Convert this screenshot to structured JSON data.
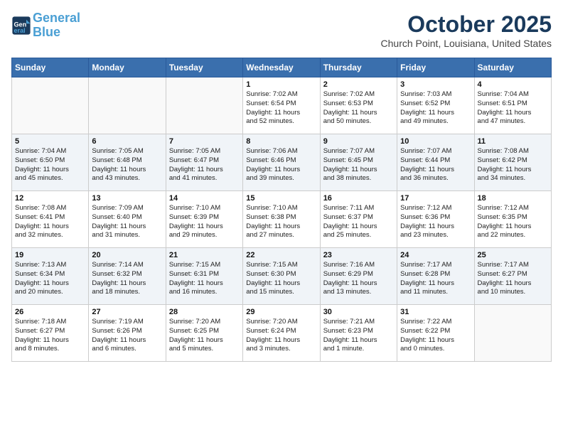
{
  "header": {
    "logo_line1": "General",
    "logo_line2": "Blue",
    "month": "October 2025",
    "location": "Church Point, Louisiana, United States"
  },
  "weekdays": [
    "Sunday",
    "Monday",
    "Tuesday",
    "Wednesday",
    "Thursday",
    "Friday",
    "Saturday"
  ],
  "weeks": [
    [
      {
        "day": "",
        "info": ""
      },
      {
        "day": "",
        "info": ""
      },
      {
        "day": "",
        "info": ""
      },
      {
        "day": "1",
        "info": "Sunrise: 7:02 AM\nSunset: 6:54 PM\nDaylight: 11 hours\nand 52 minutes."
      },
      {
        "day": "2",
        "info": "Sunrise: 7:02 AM\nSunset: 6:53 PM\nDaylight: 11 hours\nand 50 minutes."
      },
      {
        "day": "3",
        "info": "Sunrise: 7:03 AM\nSunset: 6:52 PM\nDaylight: 11 hours\nand 49 minutes."
      },
      {
        "day": "4",
        "info": "Sunrise: 7:04 AM\nSunset: 6:51 PM\nDaylight: 11 hours\nand 47 minutes."
      }
    ],
    [
      {
        "day": "5",
        "info": "Sunrise: 7:04 AM\nSunset: 6:50 PM\nDaylight: 11 hours\nand 45 minutes."
      },
      {
        "day": "6",
        "info": "Sunrise: 7:05 AM\nSunset: 6:48 PM\nDaylight: 11 hours\nand 43 minutes."
      },
      {
        "day": "7",
        "info": "Sunrise: 7:05 AM\nSunset: 6:47 PM\nDaylight: 11 hours\nand 41 minutes."
      },
      {
        "day": "8",
        "info": "Sunrise: 7:06 AM\nSunset: 6:46 PM\nDaylight: 11 hours\nand 39 minutes."
      },
      {
        "day": "9",
        "info": "Sunrise: 7:07 AM\nSunset: 6:45 PM\nDaylight: 11 hours\nand 38 minutes."
      },
      {
        "day": "10",
        "info": "Sunrise: 7:07 AM\nSunset: 6:44 PM\nDaylight: 11 hours\nand 36 minutes."
      },
      {
        "day": "11",
        "info": "Sunrise: 7:08 AM\nSunset: 6:42 PM\nDaylight: 11 hours\nand 34 minutes."
      }
    ],
    [
      {
        "day": "12",
        "info": "Sunrise: 7:08 AM\nSunset: 6:41 PM\nDaylight: 11 hours\nand 32 minutes."
      },
      {
        "day": "13",
        "info": "Sunrise: 7:09 AM\nSunset: 6:40 PM\nDaylight: 11 hours\nand 31 minutes."
      },
      {
        "day": "14",
        "info": "Sunrise: 7:10 AM\nSunset: 6:39 PM\nDaylight: 11 hours\nand 29 minutes."
      },
      {
        "day": "15",
        "info": "Sunrise: 7:10 AM\nSunset: 6:38 PM\nDaylight: 11 hours\nand 27 minutes."
      },
      {
        "day": "16",
        "info": "Sunrise: 7:11 AM\nSunset: 6:37 PM\nDaylight: 11 hours\nand 25 minutes."
      },
      {
        "day": "17",
        "info": "Sunrise: 7:12 AM\nSunset: 6:36 PM\nDaylight: 11 hours\nand 23 minutes."
      },
      {
        "day": "18",
        "info": "Sunrise: 7:12 AM\nSunset: 6:35 PM\nDaylight: 11 hours\nand 22 minutes."
      }
    ],
    [
      {
        "day": "19",
        "info": "Sunrise: 7:13 AM\nSunset: 6:34 PM\nDaylight: 11 hours\nand 20 minutes."
      },
      {
        "day": "20",
        "info": "Sunrise: 7:14 AM\nSunset: 6:32 PM\nDaylight: 11 hours\nand 18 minutes."
      },
      {
        "day": "21",
        "info": "Sunrise: 7:15 AM\nSunset: 6:31 PM\nDaylight: 11 hours\nand 16 minutes."
      },
      {
        "day": "22",
        "info": "Sunrise: 7:15 AM\nSunset: 6:30 PM\nDaylight: 11 hours\nand 15 minutes."
      },
      {
        "day": "23",
        "info": "Sunrise: 7:16 AM\nSunset: 6:29 PM\nDaylight: 11 hours\nand 13 minutes."
      },
      {
        "day": "24",
        "info": "Sunrise: 7:17 AM\nSunset: 6:28 PM\nDaylight: 11 hours\nand 11 minutes."
      },
      {
        "day": "25",
        "info": "Sunrise: 7:17 AM\nSunset: 6:27 PM\nDaylight: 11 hours\nand 10 minutes."
      }
    ],
    [
      {
        "day": "26",
        "info": "Sunrise: 7:18 AM\nSunset: 6:27 PM\nDaylight: 11 hours\nand 8 minutes."
      },
      {
        "day": "27",
        "info": "Sunrise: 7:19 AM\nSunset: 6:26 PM\nDaylight: 11 hours\nand 6 minutes."
      },
      {
        "day": "28",
        "info": "Sunrise: 7:20 AM\nSunset: 6:25 PM\nDaylight: 11 hours\nand 5 minutes."
      },
      {
        "day": "29",
        "info": "Sunrise: 7:20 AM\nSunset: 6:24 PM\nDaylight: 11 hours\nand 3 minutes."
      },
      {
        "day": "30",
        "info": "Sunrise: 7:21 AM\nSunset: 6:23 PM\nDaylight: 11 hours\nand 1 minute."
      },
      {
        "day": "31",
        "info": "Sunrise: 7:22 AM\nSunset: 6:22 PM\nDaylight: 11 hours\nand 0 minutes."
      },
      {
        "day": "",
        "info": ""
      }
    ]
  ]
}
